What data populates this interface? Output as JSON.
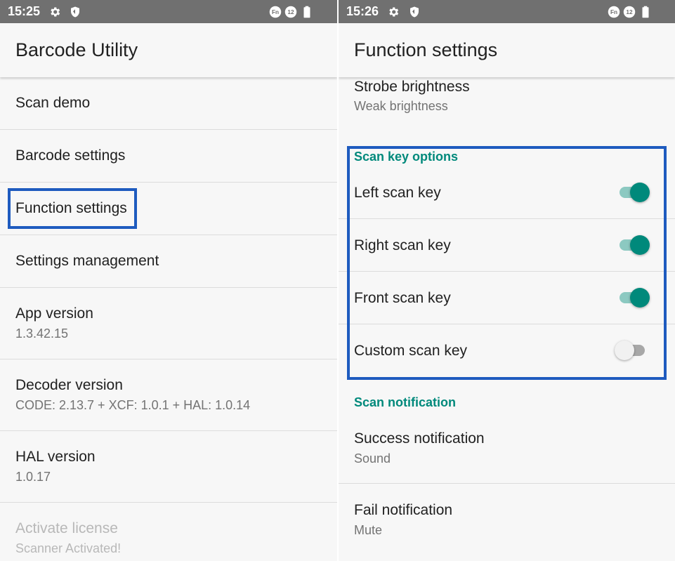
{
  "left": {
    "status": {
      "time": "15:25",
      "fn_badge": "Fn",
      "notif_count": "12"
    },
    "title": "Barcode Utility",
    "items": [
      {
        "title": "Scan demo"
      },
      {
        "title": "Barcode settings"
      },
      {
        "title": "Function settings"
      },
      {
        "title": "Settings management"
      },
      {
        "title": "App version",
        "subtitle": "1.3.42.15"
      },
      {
        "title": "Decoder version",
        "subtitle": "CODE: 2.13.7 + XCF: 1.0.1 + HAL: 1.0.14"
      },
      {
        "title": "HAL version",
        "subtitle": "1.0.17"
      },
      {
        "title": "Activate license",
        "subtitle": "Scanner Activated!"
      }
    ]
  },
  "right": {
    "status": {
      "time": "15:26",
      "fn_badge": "Fn",
      "notif_count": "12"
    },
    "title": "Function settings",
    "strobe": {
      "title": "Strobe brightness",
      "subtitle": "Weak brightness"
    },
    "scan_key_options": {
      "header": "Scan key options",
      "items": [
        {
          "title": "Left scan key",
          "enabled": true
        },
        {
          "title": "Right scan key",
          "enabled": true
        },
        {
          "title": "Front scan key",
          "enabled": true
        },
        {
          "title": "Custom scan key",
          "enabled": false
        }
      ]
    },
    "scan_notification": {
      "header": "Scan notification",
      "items": [
        {
          "title": "Success notification",
          "subtitle": "Sound"
        },
        {
          "title": "Fail notification",
          "subtitle": "Mute"
        }
      ]
    }
  },
  "colors": {
    "accent": "#00897b",
    "highlight": "#1e5bbf",
    "statusbar": "#707070"
  },
  "icons": [
    "gear-icon",
    "shield-icon",
    "fn-badge-icon",
    "notification-count-icon",
    "battery-icon"
  ]
}
